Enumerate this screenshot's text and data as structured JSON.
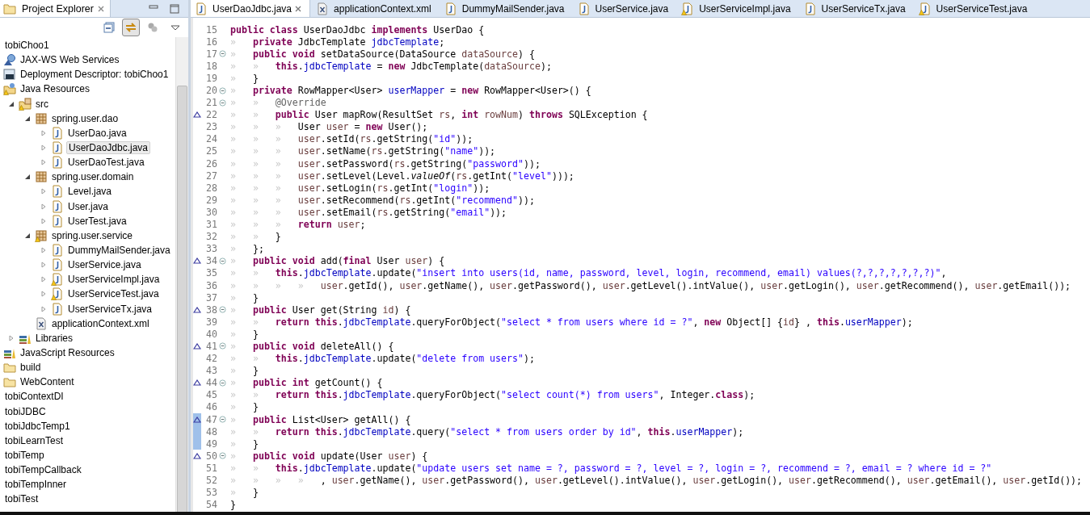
{
  "explorer": {
    "title": "Project Explorer",
    "toolbar": {
      "link_with_editor_on": true
    },
    "tree": [
      {
        "label": "tobiChoo1",
        "selected": false
      },
      {
        "label": "JAX-WS Web Services",
        "kind": "ws",
        "selected": false
      },
      {
        "label": "Deployment Descriptor: tobiChoo1",
        "kind": "dd",
        "selected": false
      },
      {
        "label": "Java Resources",
        "kind": "javares",
        "warning": true,
        "selected": false,
        "children": [
          {
            "label": "src",
            "kind": "src",
            "warning": true,
            "selected": false,
            "expanded": true,
            "children": [
              {
                "label": "spring.user.dao",
                "kind": "pkg",
                "selected": false,
                "expanded": true,
                "children": [
                  {
                    "label": "UserDao.java",
                    "kind": "java",
                    "selected": false,
                    "expanded": false
                  },
                  {
                    "label": "UserDaoJdbc.java",
                    "kind": "java",
                    "selected": true,
                    "expanded": false
                  },
                  {
                    "label": "UserDaoTest.java",
                    "kind": "java",
                    "selected": false,
                    "expanded": false
                  }
                ]
              },
              {
                "label": "spring.user.domain",
                "kind": "pkg",
                "selected": false,
                "expanded": true,
                "children": [
                  {
                    "label": "Level.java",
                    "kind": "java",
                    "selected": false,
                    "expanded": false
                  },
                  {
                    "label": "User.java",
                    "kind": "java",
                    "selected": false,
                    "expanded": false
                  },
                  {
                    "label": "UserTest.java",
                    "kind": "java",
                    "selected": false,
                    "expanded": false
                  }
                ]
              },
              {
                "label": "spring.user.service",
                "kind": "pkg",
                "warning": true,
                "selected": false,
                "expanded": true,
                "children": [
                  {
                    "label": "DummyMailSender.java",
                    "kind": "java",
                    "selected": false,
                    "expanded": false
                  },
                  {
                    "label": "UserService.java",
                    "kind": "java",
                    "selected": false,
                    "expanded": false
                  },
                  {
                    "label": "UserServiceImpl.java",
                    "kind": "java",
                    "warning": true,
                    "selected": false,
                    "expanded": false
                  },
                  {
                    "label": "UserServiceTest.java",
                    "kind": "java",
                    "warning": true,
                    "selected": false,
                    "expanded": false
                  },
                  {
                    "label": "UserServiceTx.java",
                    "kind": "java",
                    "selected": false,
                    "expanded": false
                  }
                ]
              },
              {
                "label": "applicationContext.xml",
                "kind": "xml",
                "selected": false
              }
            ]
          },
          {
            "label": "Libraries",
            "kind": "lib",
            "selected": false,
            "expanded": false
          }
        ]
      },
      {
        "label": "JavaScript Resources",
        "kind": "lib",
        "selected": false
      },
      {
        "label": "build",
        "kind": "folder",
        "selected": false
      },
      {
        "label": "WebContent",
        "kind": "folder",
        "selected": false
      },
      {
        "label": "tobiContextDI",
        "selected": false
      },
      {
        "label": "tobiJDBC",
        "selected": false
      },
      {
        "label": "tobiJdbcTemp1",
        "selected": false
      },
      {
        "label": "tobiLearnTest",
        "selected": false
      },
      {
        "label": "tobiTemp",
        "selected": false
      },
      {
        "label": "tobiTempCallback",
        "selected": false
      },
      {
        "label": "tobiTempInner",
        "selected": false
      },
      {
        "label": "tobiTest",
        "selected": false
      }
    ]
  },
  "editor": {
    "tabs": [
      {
        "label": "UserDaoJdbc.java",
        "kind": "java",
        "selected": true
      },
      {
        "label": "applicationContext.xml",
        "kind": "xml",
        "selected": false
      },
      {
        "label": "DummyMailSender.java",
        "kind": "java",
        "selected": false
      },
      {
        "label": "UserService.java",
        "kind": "java",
        "selected": false
      },
      {
        "label": "UserServiceImpl.java",
        "kind": "java",
        "warning": true,
        "selected": false
      },
      {
        "label": "UserServiceTx.java",
        "kind": "java",
        "selected": false
      },
      {
        "label": "UserServiceTest.java",
        "kind": "java",
        "warning": true,
        "selected": false
      }
    ],
    "lines": [
      {
        "n": "15",
        "fold": false,
        "override": false,
        "changed": false,
        "tokens": [
          {
            "kind": "kw",
            "text": "public class "
          },
          {
            "kind": "plain",
            "text": "UserDaoJdbc "
          },
          {
            "kind": "kw",
            "text": "implements "
          },
          {
            "kind": "plain",
            "text": "UserDao {"
          }
        ]
      },
      {
        "n": "16",
        "fold": false,
        "override": false,
        "changed": false,
        "tokens": [
          {
            "kind": "ws",
            "text": "»   "
          },
          {
            "kind": "kw",
            "text": "private "
          },
          {
            "kind": "plain",
            "text": "JdbcTemplate "
          },
          {
            "kind": "field",
            "text": "jdbcTemplate"
          },
          {
            "kind": "plain",
            "text": ";"
          }
        ]
      },
      {
        "n": "17",
        "fold": true,
        "override": false,
        "changed": false,
        "tokens": [
          {
            "kind": "ws",
            "text": "»   "
          },
          {
            "kind": "kw",
            "text": "public void "
          },
          {
            "kind": "plain",
            "text": "setDataSource(DataSource "
          },
          {
            "kind": "local",
            "text": "dataSource"
          },
          {
            "kind": "plain",
            "text": ") {"
          }
        ]
      },
      {
        "n": "18",
        "fold": false,
        "override": false,
        "changed": false,
        "tokens": [
          {
            "kind": "ws",
            "text": "»   »   "
          },
          {
            "kind": "kw",
            "text": "this"
          },
          {
            "kind": "plain",
            "text": "."
          },
          {
            "kind": "field",
            "text": "jdbcTemplate"
          },
          {
            "kind": "plain",
            "text": " = "
          },
          {
            "kind": "kw",
            "text": "new "
          },
          {
            "kind": "plain",
            "text": "JdbcTemplate("
          },
          {
            "kind": "local",
            "text": "dataSource"
          },
          {
            "kind": "plain",
            "text": ");"
          }
        ]
      },
      {
        "n": "19",
        "fold": false,
        "override": false,
        "changed": false,
        "tokens": [
          {
            "kind": "ws",
            "text": "»   "
          },
          {
            "kind": "plain",
            "text": "}"
          }
        ]
      },
      {
        "n": "20",
        "fold": true,
        "override": false,
        "changed": false,
        "tokens": [
          {
            "kind": "ws",
            "text": "»   "
          },
          {
            "kind": "kw",
            "text": "private "
          },
          {
            "kind": "plain",
            "text": "RowMapper<User> "
          },
          {
            "kind": "field",
            "text": "userMapper"
          },
          {
            "kind": "plain",
            "text": " = "
          },
          {
            "kind": "kw",
            "text": "new "
          },
          {
            "kind": "plain",
            "text": "RowMapper<User>() {"
          }
        ]
      },
      {
        "n": "21",
        "fold": true,
        "override": false,
        "changed": false,
        "tokens": [
          {
            "kind": "ws",
            "text": "»   »   "
          },
          {
            "kind": "ann",
            "text": "@Override"
          }
        ]
      },
      {
        "n": "22",
        "fold": false,
        "override": true,
        "changed": false,
        "tokens": [
          {
            "kind": "ws",
            "text": "»   »   "
          },
          {
            "kind": "kw",
            "text": "public "
          },
          {
            "kind": "plain",
            "text": "User mapRow(ResultSet "
          },
          {
            "kind": "local",
            "text": "rs"
          },
          {
            "kind": "plain",
            "text": ", "
          },
          {
            "kind": "kw",
            "text": "int "
          },
          {
            "kind": "local",
            "text": "rowNum"
          },
          {
            "kind": "plain",
            "text": ") "
          },
          {
            "kind": "kw",
            "text": "throws "
          },
          {
            "kind": "plain",
            "text": "SQLException {"
          }
        ]
      },
      {
        "n": "23",
        "fold": false,
        "override": false,
        "changed": false,
        "tokens": [
          {
            "kind": "ws",
            "text": "»   »   »   "
          },
          {
            "kind": "plain",
            "text": "User "
          },
          {
            "kind": "local",
            "text": "user"
          },
          {
            "kind": "plain",
            "text": " = "
          },
          {
            "kind": "kw",
            "text": "new "
          },
          {
            "kind": "plain",
            "text": "User();"
          }
        ]
      },
      {
        "n": "24",
        "fold": false,
        "override": false,
        "changed": false,
        "tokens": [
          {
            "kind": "ws",
            "text": "»   »   »   "
          },
          {
            "kind": "local",
            "text": "user"
          },
          {
            "kind": "plain",
            "text": ".setId("
          },
          {
            "kind": "local",
            "text": "rs"
          },
          {
            "kind": "plain",
            "text": ".getString("
          },
          {
            "kind": "str",
            "text": "\"id\""
          },
          {
            "kind": "plain",
            "text": "));"
          }
        ]
      },
      {
        "n": "25",
        "fold": false,
        "override": false,
        "changed": false,
        "tokens": [
          {
            "kind": "ws",
            "text": "»   »   »   "
          },
          {
            "kind": "local",
            "text": "user"
          },
          {
            "kind": "plain",
            "text": ".setName("
          },
          {
            "kind": "local",
            "text": "rs"
          },
          {
            "kind": "plain",
            "text": ".getString("
          },
          {
            "kind": "str",
            "text": "\"name\""
          },
          {
            "kind": "plain",
            "text": "));"
          }
        ]
      },
      {
        "n": "26",
        "fold": false,
        "override": false,
        "changed": false,
        "tokens": [
          {
            "kind": "ws",
            "text": "»   »   »   "
          },
          {
            "kind": "local",
            "text": "user"
          },
          {
            "kind": "plain",
            "text": ".setPassword("
          },
          {
            "kind": "local",
            "text": "rs"
          },
          {
            "kind": "plain",
            "text": ".getString("
          },
          {
            "kind": "str",
            "text": "\"password\""
          },
          {
            "kind": "plain",
            "text": "));"
          }
        ]
      },
      {
        "n": "27",
        "fold": false,
        "override": false,
        "changed": false,
        "tokens": [
          {
            "kind": "ws",
            "text": "»   »   »   "
          },
          {
            "kind": "local",
            "text": "user"
          },
          {
            "kind": "plain",
            "text": ".setLevel(Level."
          },
          {
            "kind": "static",
            "text": "valueOf"
          },
          {
            "kind": "plain",
            "text": "("
          },
          {
            "kind": "local",
            "text": "rs"
          },
          {
            "kind": "plain",
            "text": ".getInt("
          },
          {
            "kind": "str",
            "text": "\"level\""
          },
          {
            "kind": "plain",
            "text": ")));"
          }
        ]
      },
      {
        "n": "28",
        "fold": false,
        "override": false,
        "changed": false,
        "tokens": [
          {
            "kind": "ws",
            "text": "»   »   »   "
          },
          {
            "kind": "local",
            "text": "user"
          },
          {
            "kind": "plain",
            "text": ".setLogin("
          },
          {
            "kind": "local",
            "text": "rs"
          },
          {
            "kind": "plain",
            "text": ".getInt("
          },
          {
            "kind": "str",
            "text": "\"login\""
          },
          {
            "kind": "plain",
            "text": "));"
          }
        ]
      },
      {
        "n": "29",
        "fold": false,
        "override": false,
        "changed": false,
        "tokens": [
          {
            "kind": "ws",
            "text": "»   »   »   "
          },
          {
            "kind": "local",
            "text": "user"
          },
          {
            "kind": "plain",
            "text": ".setRecommend("
          },
          {
            "kind": "local",
            "text": "rs"
          },
          {
            "kind": "plain",
            "text": ".getInt("
          },
          {
            "kind": "str",
            "text": "\"recommend\""
          },
          {
            "kind": "plain",
            "text": "));"
          }
        ]
      },
      {
        "n": "30",
        "fold": false,
        "override": false,
        "changed": false,
        "tokens": [
          {
            "kind": "ws",
            "text": "»   »   »   "
          },
          {
            "kind": "local",
            "text": "user"
          },
          {
            "kind": "plain",
            "text": ".setEmail("
          },
          {
            "kind": "local",
            "text": "rs"
          },
          {
            "kind": "plain",
            "text": ".getString("
          },
          {
            "kind": "str",
            "text": "\"email\""
          },
          {
            "kind": "plain",
            "text": "));"
          }
        ]
      },
      {
        "n": "31",
        "fold": false,
        "override": false,
        "changed": false,
        "tokens": [
          {
            "kind": "ws",
            "text": "»   »   »   "
          },
          {
            "kind": "kw",
            "text": "return "
          },
          {
            "kind": "local",
            "text": "user"
          },
          {
            "kind": "plain",
            "text": ";"
          }
        ]
      },
      {
        "n": "32",
        "fold": false,
        "override": false,
        "changed": false,
        "tokens": [
          {
            "kind": "ws",
            "text": "»   »   "
          },
          {
            "kind": "plain",
            "text": "}"
          }
        ]
      },
      {
        "n": "33",
        "fold": false,
        "override": false,
        "changed": false,
        "tokens": [
          {
            "kind": "ws",
            "text": "»   "
          },
          {
            "kind": "plain",
            "text": "};"
          }
        ]
      },
      {
        "n": "34",
        "fold": true,
        "override": true,
        "changed": false,
        "tokens": [
          {
            "kind": "ws",
            "text": "»   "
          },
          {
            "kind": "kw",
            "text": "public void "
          },
          {
            "kind": "plain",
            "text": "add("
          },
          {
            "kind": "kw",
            "text": "final "
          },
          {
            "kind": "plain",
            "text": "User "
          },
          {
            "kind": "local",
            "text": "user"
          },
          {
            "kind": "plain",
            "text": ") {"
          }
        ]
      },
      {
        "n": "35",
        "fold": false,
        "override": false,
        "changed": false,
        "tokens": [
          {
            "kind": "ws",
            "text": "»   »   "
          },
          {
            "kind": "kw",
            "text": "this"
          },
          {
            "kind": "plain",
            "text": "."
          },
          {
            "kind": "field",
            "text": "jdbcTemplate"
          },
          {
            "kind": "plain",
            "text": ".update("
          },
          {
            "kind": "str",
            "text": "\"insert into users(id, name, password, level, login, recommend, email) values(?,?,?,?,?,?,?)\""
          },
          {
            "kind": "plain",
            "text": ","
          }
        ]
      },
      {
        "n": "36",
        "fold": false,
        "override": false,
        "changed": false,
        "tokens": [
          {
            "kind": "ws",
            "text": "»   »   »   »   "
          },
          {
            "kind": "local",
            "text": "user"
          },
          {
            "kind": "plain",
            "text": ".getId(), "
          },
          {
            "kind": "local",
            "text": "user"
          },
          {
            "kind": "plain",
            "text": ".getName(), "
          },
          {
            "kind": "local",
            "text": "user"
          },
          {
            "kind": "plain",
            "text": ".getPassword(), "
          },
          {
            "kind": "local",
            "text": "user"
          },
          {
            "kind": "plain",
            "text": ".getLevel().intValue(), "
          },
          {
            "kind": "local",
            "text": "user"
          },
          {
            "kind": "plain",
            "text": ".getLogin(), "
          },
          {
            "kind": "local",
            "text": "user"
          },
          {
            "kind": "plain",
            "text": ".getRecommend(), "
          },
          {
            "kind": "local",
            "text": "user"
          },
          {
            "kind": "plain",
            "text": ".getEmail());"
          }
        ]
      },
      {
        "n": "37",
        "fold": false,
        "override": false,
        "changed": false,
        "tokens": [
          {
            "kind": "ws",
            "text": "»   "
          },
          {
            "kind": "plain",
            "text": "}"
          }
        ]
      },
      {
        "n": "38",
        "fold": true,
        "override": true,
        "changed": false,
        "tokens": [
          {
            "kind": "ws",
            "text": "»   "
          },
          {
            "kind": "kw",
            "text": "public "
          },
          {
            "kind": "plain",
            "text": "User get(String "
          },
          {
            "kind": "local",
            "text": "id"
          },
          {
            "kind": "plain",
            "text": ") {"
          }
        ]
      },
      {
        "n": "39",
        "fold": false,
        "override": false,
        "changed": false,
        "tokens": [
          {
            "kind": "ws",
            "text": "»   »   "
          },
          {
            "kind": "kw",
            "text": "return this"
          },
          {
            "kind": "plain",
            "text": "."
          },
          {
            "kind": "field",
            "text": "jdbcTemplate"
          },
          {
            "kind": "plain",
            "text": ".queryForObject("
          },
          {
            "kind": "str",
            "text": "\"select * from users where id = ?\""
          },
          {
            "kind": "plain",
            "text": ", "
          },
          {
            "kind": "kw",
            "text": "new "
          },
          {
            "kind": "plain",
            "text": "Object[] {"
          },
          {
            "kind": "local",
            "text": "id"
          },
          {
            "kind": "plain",
            "text": "} , "
          },
          {
            "kind": "kw",
            "text": "this"
          },
          {
            "kind": "plain",
            "text": "."
          },
          {
            "kind": "field",
            "text": "userMapper"
          },
          {
            "kind": "plain",
            "text": ");"
          }
        ]
      },
      {
        "n": "40",
        "fold": false,
        "override": false,
        "changed": false,
        "tokens": [
          {
            "kind": "ws",
            "text": "»   "
          },
          {
            "kind": "plain",
            "text": "}"
          }
        ]
      },
      {
        "n": "41",
        "fold": true,
        "override": true,
        "changed": false,
        "tokens": [
          {
            "kind": "ws",
            "text": "»   "
          },
          {
            "kind": "kw",
            "text": "public void "
          },
          {
            "kind": "plain",
            "text": "deleteAll() {"
          }
        ]
      },
      {
        "n": "42",
        "fold": false,
        "override": false,
        "changed": false,
        "tokens": [
          {
            "kind": "ws",
            "text": "»   »   "
          },
          {
            "kind": "kw",
            "text": "this"
          },
          {
            "kind": "plain",
            "text": "."
          },
          {
            "kind": "field",
            "text": "jdbcTemplate"
          },
          {
            "kind": "plain",
            "text": ".update("
          },
          {
            "kind": "str",
            "text": "\"delete from users\""
          },
          {
            "kind": "plain",
            "text": ");"
          }
        ]
      },
      {
        "n": "43",
        "fold": false,
        "override": false,
        "changed": false,
        "tokens": [
          {
            "kind": "ws",
            "text": "»   "
          },
          {
            "kind": "plain",
            "text": "}"
          }
        ]
      },
      {
        "n": "44",
        "fold": true,
        "override": true,
        "changed": false,
        "tokens": [
          {
            "kind": "ws",
            "text": "»   "
          },
          {
            "kind": "kw",
            "text": "public int "
          },
          {
            "kind": "plain",
            "text": "getCount() {"
          }
        ]
      },
      {
        "n": "45",
        "fold": false,
        "override": false,
        "changed": false,
        "tokens": [
          {
            "kind": "ws",
            "text": "»   »   "
          },
          {
            "kind": "kw",
            "text": "return this"
          },
          {
            "kind": "plain",
            "text": "."
          },
          {
            "kind": "field",
            "text": "jdbcTemplate"
          },
          {
            "kind": "plain",
            "text": ".queryForObject("
          },
          {
            "kind": "str",
            "text": "\"select count(*) from users\""
          },
          {
            "kind": "plain",
            "text": ", Integer."
          },
          {
            "kind": "kw",
            "text": "class"
          },
          {
            "kind": "plain",
            "text": ");"
          }
        ]
      },
      {
        "n": "46",
        "fold": false,
        "override": false,
        "changed": false,
        "tokens": [
          {
            "kind": "ws",
            "text": "»   "
          },
          {
            "kind": "plain",
            "text": "}"
          }
        ]
      },
      {
        "n": "47",
        "fold": true,
        "override": true,
        "changed": true,
        "tokens": [
          {
            "kind": "ws",
            "text": "»   "
          },
          {
            "kind": "kw",
            "text": "public "
          },
          {
            "kind": "plain",
            "text": "List<User> getAll() {"
          }
        ]
      },
      {
        "n": "48",
        "fold": false,
        "override": false,
        "changed": true,
        "tokens": [
          {
            "kind": "ws",
            "text": "»   »   "
          },
          {
            "kind": "kw",
            "text": "return this"
          },
          {
            "kind": "plain",
            "text": "."
          },
          {
            "kind": "field",
            "text": "jdbcTemplate"
          },
          {
            "kind": "plain",
            "text": ".query("
          },
          {
            "kind": "str",
            "text": "\"select * from users order by id\""
          },
          {
            "kind": "plain",
            "text": ", "
          },
          {
            "kind": "kw",
            "text": "this"
          },
          {
            "kind": "plain",
            "text": "."
          },
          {
            "kind": "field",
            "text": "userMapper"
          },
          {
            "kind": "plain",
            "text": ");"
          }
        ]
      },
      {
        "n": "49",
        "fold": false,
        "override": false,
        "changed": true,
        "tokens": [
          {
            "kind": "ws",
            "text": "»   "
          },
          {
            "kind": "plain",
            "text": "}"
          }
        ]
      },
      {
        "n": "50",
        "fold": true,
        "override": true,
        "changed": false,
        "tokens": [
          {
            "kind": "ws",
            "text": "»   "
          },
          {
            "kind": "kw",
            "text": "public void "
          },
          {
            "kind": "plain",
            "text": "update(User "
          },
          {
            "kind": "local",
            "text": "user"
          },
          {
            "kind": "plain",
            "text": ") {"
          }
        ]
      },
      {
        "n": "51",
        "fold": false,
        "override": false,
        "changed": false,
        "tokens": [
          {
            "kind": "ws",
            "text": "»   »   "
          },
          {
            "kind": "kw",
            "text": "this"
          },
          {
            "kind": "plain",
            "text": "."
          },
          {
            "kind": "field",
            "text": "jdbcTemplate"
          },
          {
            "kind": "plain",
            "text": ".update("
          },
          {
            "kind": "str",
            "text": "\"update users set name = ?, password = ?, level = ?, login = ?, recommend = ?, email = ? where id = ?\""
          }
        ]
      },
      {
        "n": "52",
        "fold": false,
        "override": false,
        "changed": false,
        "tokens": [
          {
            "kind": "ws",
            "text": "»   »   »   »   "
          },
          {
            "kind": "plain",
            "text": ", "
          },
          {
            "kind": "local",
            "text": "user"
          },
          {
            "kind": "plain",
            "text": ".getName(), "
          },
          {
            "kind": "local",
            "text": "user"
          },
          {
            "kind": "plain",
            "text": ".getPassword(), "
          },
          {
            "kind": "local",
            "text": "user"
          },
          {
            "kind": "plain",
            "text": ".getLevel().intValue(), "
          },
          {
            "kind": "local",
            "text": "user"
          },
          {
            "kind": "plain",
            "text": ".getLogin(), "
          },
          {
            "kind": "local",
            "text": "user"
          },
          {
            "kind": "plain",
            "text": ".getRecommend(), "
          },
          {
            "kind": "local",
            "text": "user"
          },
          {
            "kind": "plain",
            "text": ".getEmail(), "
          },
          {
            "kind": "local",
            "text": "user"
          },
          {
            "kind": "plain",
            "text": ".getId());"
          }
        ]
      },
      {
        "n": "53",
        "fold": false,
        "override": false,
        "changed": false,
        "tokens": [
          {
            "kind": "ws",
            "text": "»   "
          },
          {
            "kind": "plain",
            "text": "}"
          }
        ]
      },
      {
        "n": "54",
        "fold": false,
        "override": false,
        "changed": false,
        "tokens": [
          {
            "kind": "plain",
            "text": "}"
          }
        ]
      }
    ]
  }
}
